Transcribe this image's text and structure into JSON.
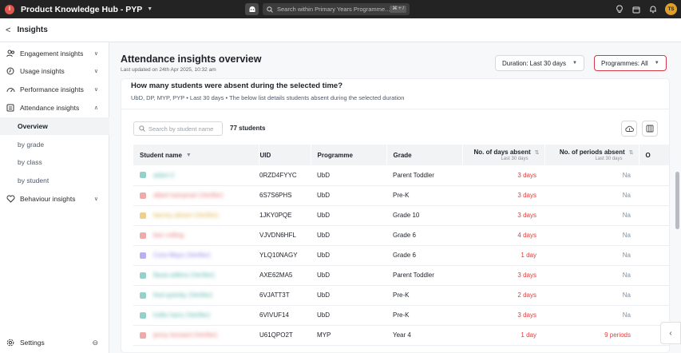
{
  "topbar": {
    "logo_letter": "I",
    "app_title": "Product Knowledge Hub - PYP",
    "search_placeholder": "Search within Primary Years Programme...",
    "search_shortcut": "⌘ + /",
    "avatar_initials": "TS",
    "colors": {
      "background": "#232323",
      "logo": "#e2574c",
      "avatar": "#e0a028"
    }
  },
  "header": {
    "back_label": "<",
    "title": "Insights"
  },
  "sidebar": {
    "items": [
      {
        "label": "Engagement insights",
        "icon": "engagement-icon",
        "expanded": false
      },
      {
        "label": "Usage insights",
        "icon": "usage-icon",
        "expanded": false
      },
      {
        "label": "Performance insights",
        "icon": "gauge-icon",
        "expanded": false
      },
      {
        "label": "Attendance insights",
        "icon": "attendance-icon",
        "expanded": true
      },
      {
        "label": "Behaviour insights",
        "icon": "heart-icon",
        "expanded": false
      }
    ],
    "attendance_subitems": [
      {
        "label": "Overview",
        "active": true
      },
      {
        "label": "by grade",
        "active": false
      },
      {
        "label": "by class",
        "active": false
      },
      {
        "label": "by student",
        "active": false
      }
    ],
    "settings_label": "Settings"
  },
  "main": {
    "title": "Attendance insights overview",
    "updated": "Last updated on 24th Apr 2025, 10:32 am",
    "duration_label": "Duration: Last 30 days",
    "programmes_label": "Programmes: All",
    "question": "How many students were absent during the selected time?",
    "subtitle": "UbD, DP, MYP, PYP  •  Last 30 days  •  The below list details students absent during the selected duration",
    "search_placeholder": "Search by student name",
    "student_count": "77 students",
    "colors": {
      "accent_red": "#e23d3d",
      "highlight_border": "#d8394a"
    }
  },
  "table": {
    "columns": {
      "student": "Student name",
      "uid": "UID",
      "programme": "Programme",
      "grade": "Grade",
      "days_absent": "No. of days absent",
      "days_absent_sub": "Last 30 days",
      "periods_absent": "No. of periods absent",
      "periods_absent_sub": "Last 30 days",
      "overflow": "O"
    },
    "rows": [
      {
        "name": "adam il",
        "uid": "0RZD4FYYC",
        "programme": "UbD",
        "grade": "Parent Toddler",
        "days": "3 days",
        "periods": "Na",
        "color": "#4fb3a9"
      },
      {
        "name": "albert kampnari (Verifier)",
        "uid": "6S7S6PHS",
        "programme": "UbD",
        "grade": "Pre-K",
        "days": "3 days",
        "periods": "Na",
        "color": "#e57373"
      },
      {
        "name": "barney abram (Verifier)",
        "uid": "1JKY0PQE",
        "programme": "UbD",
        "grade": "Grade 10",
        "days": "3 days",
        "periods": "Na",
        "color": "#e0b040"
      },
      {
        "name": "ben colling",
        "uid": "VJVDN6HFL",
        "programme": "UbD",
        "grade": "Grade 6",
        "days": "4 days",
        "periods": "Na",
        "color": "#e57373"
      },
      {
        "name": "Cora Mayo (Verifier)",
        "uid": "YLQ10NAGY",
        "programme": "UbD",
        "grade": "Grade 6",
        "days": "1 day",
        "periods": "Na",
        "color": "#8c7ae6"
      },
      {
        "name": "flavia wilkins (Verifier)",
        "uid": "AXE62MA5",
        "programme": "UbD",
        "grade": "Parent Toddler",
        "days": "3 days",
        "periods": "Na",
        "color": "#4fb3a9"
      },
      {
        "name": "fred quimby (Verifier)",
        "uid": "6VJATT3T",
        "programme": "UbD",
        "grade": "Pre-K",
        "days": "2 days",
        "periods": "Na",
        "color": "#4fb3a9"
      },
      {
        "name": "hollis harry (Verifier)",
        "uid": "6VIVUF14",
        "programme": "UbD",
        "grade": "Pre-K",
        "days": "3 days",
        "periods": "Na",
        "color": "#4fb3a9"
      },
      {
        "name": "jenny leonard (Verifier)",
        "uid": "U61QPO2T",
        "programme": "MYP",
        "grade": "Year 4",
        "days": "1 day",
        "periods": "9 periods",
        "color": "#e57373"
      }
    ]
  }
}
